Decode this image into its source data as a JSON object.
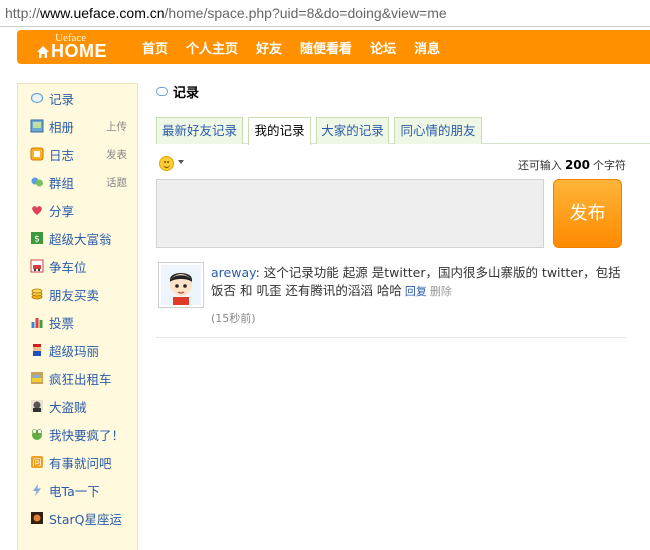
{
  "browser": {
    "url_prefix": "http://",
    "url_host": "www.ueface.com.cn",
    "url_path": "/home/space.php?uid=8&do=doing&view=me"
  },
  "logo": {
    "small": "Ueface",
    "main": "HOME"
  },
  "nav": [
    "首页",
    "个人主页",
    "好友",
    "随便看看",
    "论坛",
    "消息"
  ],
  "sidebar": {
    "items": [
      {
        "label": "记录",
        "icon": "speech-bubble-icon",
        "extra": ""
      },
      {
        "label": "相册",
        "icon": "photo-album-icon",
        "extra": "上传"
      },
      {
        "label": "日志",
        "icon": "blog-icon",
        "extra": "发表"
      },
      {
        "label": "群组",
        "icon": "group-icon",
        "extra": "话题"
      },
      {
        "label": "分享",
        "icon": "share-heart-icon",
        "extra": ""
      },
      {
        "label": "超级大富翁",
        "icon": "money-icon",
        "extra": ""
      },
      {
        "label": "争车位",
        "icon": "car-icon",
        "extra": ""
      },
      {
        "label": "朋友买卖",
        "icon": "coins-icon",
        "extra": ""
      },
      {
        "label": "投票",
        "icon": "poll-chart-icon",
        "extra": ""
      },
      {
        "label": "超级玛丽",
        "icon": "mario-icon",
        "extra": ""
      },
      {
        "label": "疯狂出租车",
        "icon": "taxi-icon",
        "extra": ""
      },
      {
        "label": "大盗贼",
        "icon": "thief-icon",
        "extra": ""
      },
      {
        "label": "我快要疯了！",
        "icon": "crazy-frog-icon",
        "extra": ""
      },
      {
        "label": "有事就问吧",
        "icon": "ask-icon",
        "extra": ""
      },
      {
        "label": "电Ta一下",
        "icon": "lightning-icon",
        "extra": ""
      },
      {
        "label": "StarQ星座运",
        "icon": "star-sign-icon",
        "extra": ""
      }
    ]
  },
  "main": {
    "title": "记录",
    "tabs": [
      "最新好友记录",
      "我的记录",
      "大家的记录",
      "同心情的朋友"
    ],
    "active_tab": 1,
    "remaining_prefix": "还可输入",
    "remaining_count": "200",
    "remaining_suffix": "个字符",
    "publish_label": "发布",
    "post": {
      "user": "areway",
      "text": ": 这个记录功能 起源 是twitter，国内很多山寨版的 twitter，包括 饭否 和 叽歪 还有腾讯的滔滔 哈哈",
      "reply": "回复",
      "delete": "删除",
      "time": "(15秒前)"
    }
  },
  "colors": {
    "accent": "#ff9000",
    "link": "#2b5ca8",
    "sidebar_bg": "#fff9de"
  }
}
